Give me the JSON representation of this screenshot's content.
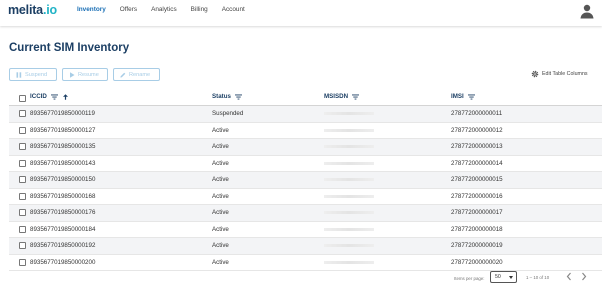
{
  "brand": {
    "name_main": "melita",
    "name_suffix": ".io"
  },
  "nav": {
    "items": [
      {
        "label": "Inventory"
      },
      {
        "label": "Offers"
      },
      {
        "label": "Analytics"
      },
      {
        "label": "Billing"
      },
      {
        "label": "Account"
      }
    ],
    "active_item": "Inventory"
  },
  "page": {
    "title": "Current SIM Inventory"
  },
  "toolbar": {
    "suspend_label": "Suspend",
    "resume_label": "Resume",
    "rename_label": "Rename",
    "edit_columns_label": "Edit Table Columns"
  },
  "table": {
    "headers": {
      "iccid": "ICCID",
      "status": "Status",
      "msisdn": "MSISDN",
      "imsi": "IMSI"
    },
    "sort": {
      "column": "ICCID",
      "direction": "ascending"
    },
    "rows": [
      {
        "iccid": "8935677019850000119",
        "status": "Suspended",
        "imsi": "278772000000011"
      },
      {
        "iccid": "8935677019850000127",
        "status": "Active",
        "imsi": "278772000000012"
      },
      {
        "iccid": "8935677019850000135",
        "status": "Active",
        "imsi": "278772000000013"
      },
      {
        "iccid": "8935677019850000143",
        "status": "Active",
        "imsi": "278772000000014"
      },
      {
        "iccid": "8935677019850000150",
        "status": "Active",
        "imsi": "278772000000015"
      },
      {
        "iccid": "8935677019850000168",
        "status": "Active",
        "imsi": "278772000000016"
      },
      {
        "iccid": "8935677019850000176",
        "status": "Active",
        "imsi": "278772000000017"
      },
      {
        "iccid": "8935677019850000184",
        "status": "Active",
        "imsi": "278772000000018"
      },
      {
        "iccid": "8935677019850000192",
        "status": "Active",
        "imsi": "278772000000019"
      },
      {
        "iccid": "8935677019850000200",
        "status": "Active",
        "imsi": "278772000000020"
      }
    ]
  },
  "pagination": {
    "items_per_page_label": "Items per page:",
    "items_per_page_value": "50",
    "range_label": "1 – 10 of 10"
  },
  "colors": {
    "brand_dark": "#1c3f64",
    "brand_accent": "#21b3c6",
    "nav_active": "#1a6fb5",
    "button_disabled": "#a8cde6",
    "row_alt": "#f3f4f6"
  },
  "icons": {
    "user": "account-circle-icon",
    "suspend": "pause-icon",
    "resume": "play-icon",
    "rename": "pencil-icon",
    "edit_columns": "gear-icon",
    "filter": "filter-lines-icon",
    "sort": "arrow-up-icon",
    "prev": "chevron-left-icon",
    "next": "chevron-right-icon"
  }
}
